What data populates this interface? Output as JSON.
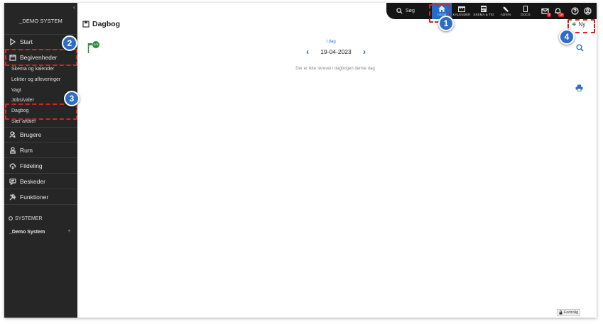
{
  "sidebar": {
    "collapse_glyph": "‹",
    "brand": "_DEMO SYSTEM",
    "items": [
      {
        "label": "Start",
        "icon": "play-icon"
      },
      {
        "label": "Begivenheder",
        "icon": "calendar-icon"
      },
      {
        "label": "Brugere",
        "icon": "users-icon"
      },
      {
        "label": "Rum",
        "icon": "room-icon"
      },
      {
        "label": "Fildeling",
        "icon": "cloud-icon"
      },
      {
        "label": "Beskeder",
        "icon": "chat-icon"
      },
      {
        "label": "Funktioner",
        "icon": "tools-icon"
      }
    ],
    "sub_items": [
      "Skema og kalender",
      "Lektier og afleveringer",
      "Vagt",
      "Jobs/valer",
      "Dagbog",
      "Sær aftaler"
    ],
    "systems_title": "SYSTEMER",
    "system_name": "_Demo System",
    "system_caret": "▼"
  },
  "topbar": {
    "search_label": "Søg",
    "buttons": [
      "HJEM",
      "KALENDER",
      "SKEMA & TID",
      "ADVIN",
      "DOCS"
    ],
    "mail_badge": "5",
    "notif_badge": "18",
    "help_glyph": "?",
    "user_icon": "user-icon"
  },
  "page": {
    "title": "Dagbog",
    "new_label": "Ny",
    "flag_badge": "4/4",
    "today_label": "I dag",
    "date": "19-04-2023",
    "prev_glyph": "‹",
    "next_glyph": "›",
    "empty_message": "Der er ikke skrevet i dagbogen denne dag",
    "footer_label": "Fortrolig"
  },
  "annotations": [
    "1",
    "2",
    "3",
    "4"
  ],
  "colors": {
    "sidebar_bg": "#262626",
    "topbar_bg": "#151515",
    "accent": "#1f6fd1",
    "highlight": "#d6231f",
    "marker": "#2e6dc6"
  }
}
